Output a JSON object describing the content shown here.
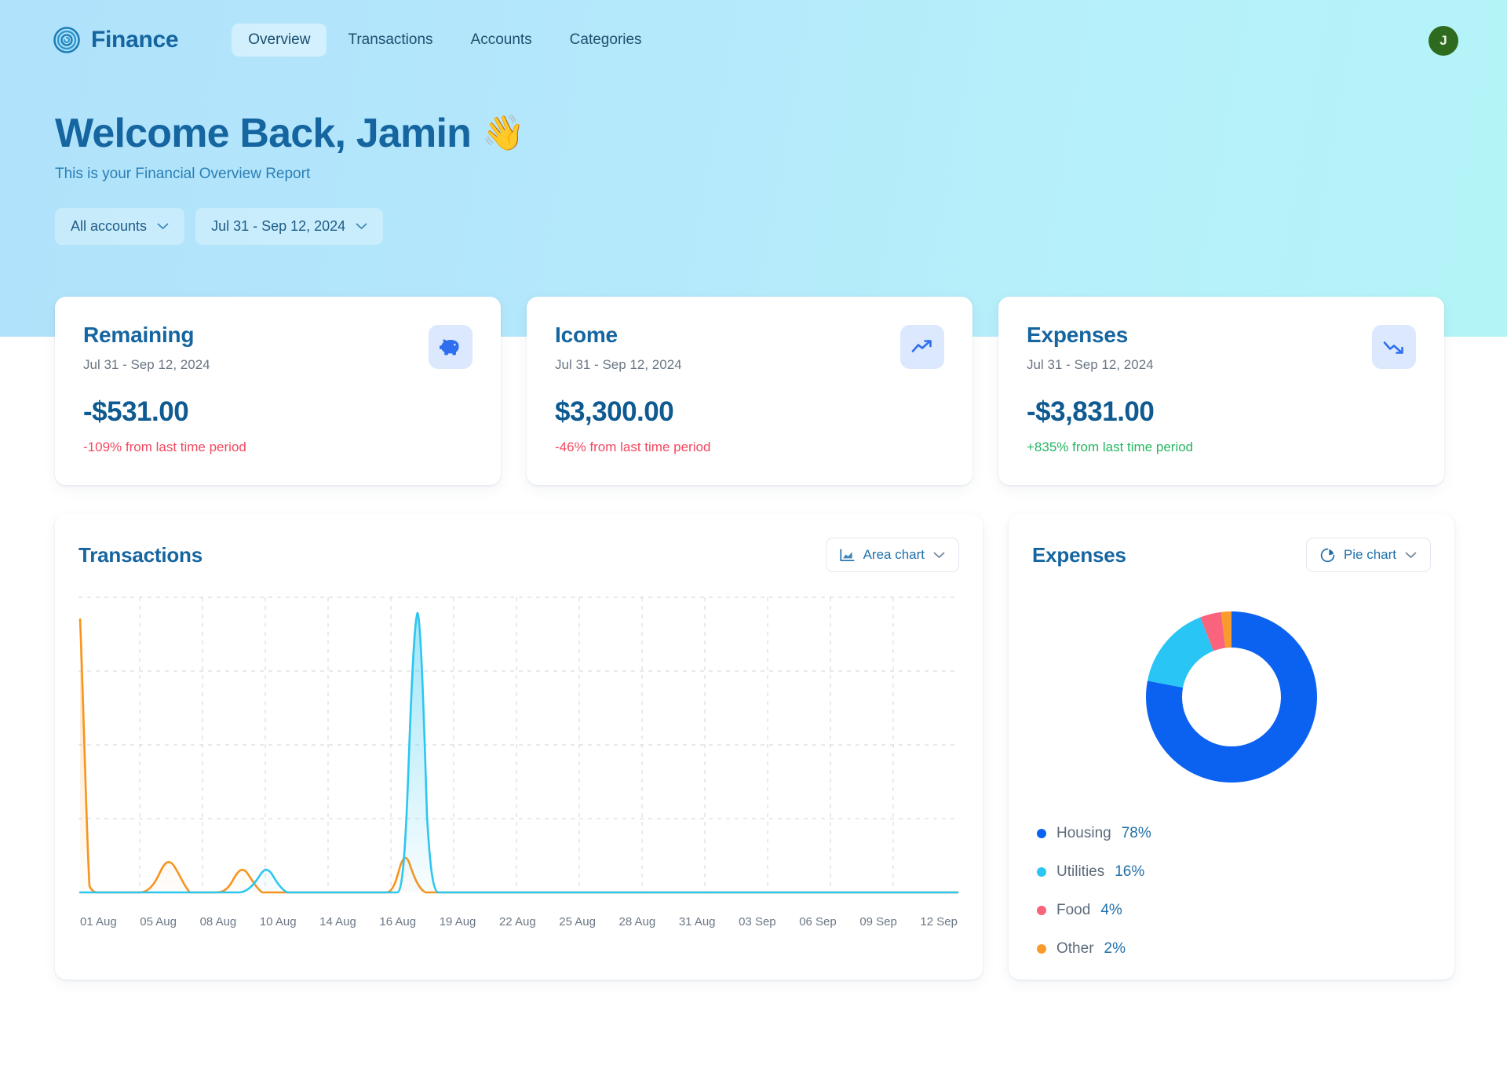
{
  "brand": {
    "name": "Finance",
    "logo_icon": "spiral-icon"
  },
  "nav": {
    "items": [
      {
        "label": "Overview",
        "active": true
      },
      {
        "label": "Transactions",
        "active": false
      },
      {
        "label": "Accounts",
        "active": false
      },
      {
        "label": "Categories",
        "active": false
      }
    ]
  },
  "avatar": {
    "initial": "J",
    "color": "#2f6b1f"
  },
  "welcome": {
    "heading": "Welcome Back, Jamin",
    "wave_emoji": "👋",
    "subheading": "This is your Financial Overview Report"
  },
  "filters": [
    {
      "label": "All accounts",
      "icon": "chevron-down-icon"
    },
    {
      "label": "Jul 31 - Sep 12, 2024",
      "icon": "chevron-down-icon"
    }
  ],
  "kpis": [
    {
      "title": "Remaining",
      "range": "Jul 31 - Sep 12, 2024",
      "value": "-$531.00",
      "delta": "-109% from last time period",
      "delta_sign": "neg",
      "icon": "piggy-bank-icon"
    },
    {
      "title": "Icome",
      "range": "Jul 31 - Sep 12, 2024",
      "value": "$3,300.00",
      "delta": "-46% from last time period",
      "delta_sign": "neg",
      "icon": "trending-up-icon"
    },
    {
      "title": "Expenses",
      "range": "Jul 31 - Sep 12, 2024",
      "value": "-$3,831.00",
      "delta": "+835% from last time period",
      "delta_sign": "pos",
      "icon": "trending-down-icon"
    }
  ],
  "transactions_panel": {
    "title": "Transactions",
    "chart_select": {
      "label": "Area chart",
      "icon": "area-chart-icon",
      "chevron": "chevron-down-icon"
    }
  },
  "expenses_panel": {
    "title": "Expenses",
    "chart_select": {
      "label": "Pie chart",
      "icon": "pie-chart-icon",
      "chevron": "chevron-down-icon"
    }
  },
  "colors": {
    "income": "#2dc6ef",
    "expenses": "#f7941e",
    "housing": "#0c62f0",
    "utilities": "#29c6f5",
    "food": "#f9637c",
    "other": "#f89b2a",
    "heading": "#1565a0",
    "positive": "#26b562",
    "negative": "#f2485f"
  },
  "chart_data": [
    {
      "type": "area",
      "title": "Transactions",
      "xlabel": "",
      "ylabel": "",
      "grid": true,
      "legend_position": "none",
      "xtick_labels": [
        "01 Aug",
        "05 Aug",
        "08 Aug",
        "10 Aug",
        "14 Aug",
        "16 Aug",
        "19 Aug",
        "22 Aug",
        "25 Aug",
        "28 Aug",
        "31 Aug",
        "03 Sep",
        "06 Sep",
        "09 Sep",
        "12 Sep"
      ],
      "x": [
        "01 Aug",
        "02 Aug",
        "03 Aug",
        "04 Aug",
        "05 Aug",
        "06 Aug",
        "07 Aug",
        "08 Aug",
        "09 Aug",
        "10 Aug",
        "11 Aug",
        "12 Aug",
        "13 Aug",
        "14 Aug",
        "15 Aug",
        "16 Aug",
        "17 Aug",
        "18 Aug",
        "19 Aug",
        "20 Aug",
        "21 Aug",
        "22 Aug",
        "23 Aug",
        "24 Aug",
        "25 Aug",
        "26 Aug",
        "27 Aug",
        "28 Aug",
        "29 Aug",
        "30 Aug",
        "31 Aug",
        "01 Sep",
        "02 Sep",
        "03 Sep",
        "04 Sep",
        "05 Sep",
        "06 Sep",
        "07 Sep",
        "08 Sep",
        "09 Sep",
        "10 Sep",
        "11 Sep",
        "12 Sep"
      ],
      "ylim": [
        0,
        3100
      ],
      "series": [
        {
          "name": "Expenses",
          "color": "#f7941e",
          "values": [
            2900,
            0,
            0,
            0,
            250,
            0,
            0,
            130,
            0,
            0,
            0,
            0,
            0,
            330,
            0,
            0,
            0,
            0,
            0,
            0,
            0,
            0,
            0,
            0,
            0,
            0,
            0,
            0,
            0,
            0,
            0,
            0,
            0,
            0,
            0,
            0,
            0,
            0,
            0,
            0,
            0,
            0,
            0
          ]
        },
        {
          "name": "Income",
          "color": "#2dc6ef",
          "values": [
            0,
            0,
            0,
            0,
            0,
            0,
            0,
            0,
            0,
            190,
            0,
            0,
            0,
            0,
            3000,
            0,
            0,
            0,
            0,
            0,
            0,
            0,
            0,
            0,
            0,
            0,
            0,
            0,
            0,
            0,
            0,
            0,
            0,
            0,
            0,
            0,
            0,
            0,
            0,
            0,
            0,
            0,
            0
          ]
        }
      ]
    },
    {
      "type": "pie",
      "title": "Expenses",
      "donut": true,
      "legend_position": "bottom-left",
      "categories": [
        "Housing",
        "Utilities",
        "Food",
        "Other"
      ],
      "values": [
        78,
        16,
        4,
        2
      ],
      "value_suffix": "%",
      "colors": [
        "#0c62f0",
        "#29c6f5",
        "#f9637c",
        "#f89b2a"
      ],
      "legend": [
        {
          "label": "Housing",
          "pct": "78%",
          "color": "#0c62f0"
        },
        {
          "label": "Utilities",
          "pct": "16%",
          "color": "#29c6f5"
        },
        {
          "label": "Food",
          "pct": "4%",
          "color": "#f9637c"
        },
        {
          "label": "Other",
          "pct": "2%",
          "color": "#f89b2a"
        }
      ]
    }
  ]
}
